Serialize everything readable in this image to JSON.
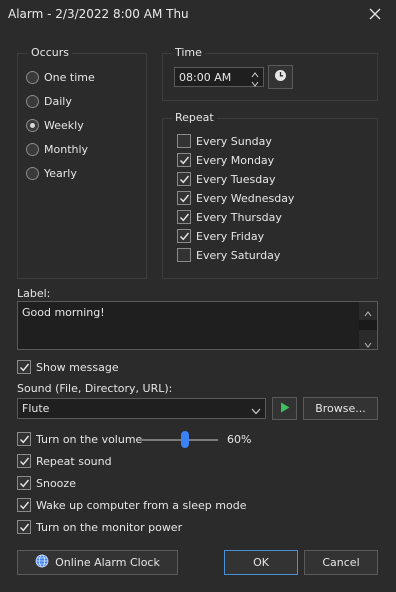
{
  "window": {
    "title": "Alarm - 2/3/2022 8:00 AM Thu"
  },
  "occurs": {
    "legend": "Occurs",
    "options": [
      {
        "label": "One time",
        "selected": false
      },
      {
        "label": "Daily",
        "selected": false
      },
      {
        "label": "Weekly",
        "selected": true
      },
      {
        "label": "Monthly",
        "selected": false
      },
      {
        "label": "Yearly",
        "selected": false
      }
    ]
  },
  "time": {
    "legend": "Time",
    "value": "08:00 AM"
  },
  "repeat": {
    "legend": "Repeat",
    "days": [
      {
        "label": "Every Sunday",
        "checked": false
      },
      {
        "label": "Every Monday",
        "checked": true
      },
      {
        "label": "Every Tuesday",
        "checked": true
      },
      {
        "label": "Every Wednesday",
        "checked": true
      },
      {
        "label": "Every Thursday",
        "checked": true
      },
      {
        "label": "Every Friday",
        "checked": true
      },
      {
        "label": "Every Saturday",
        "checked": false
      }
    ]
  },
  "label": {
    "caption": "Label:",
    "value": "Good morning!"
  },
  "show_message": {
    "label": "Show message",
    "checked": true
  },
  "sound": {
    "caption": "Sound (File, Directory, URL):",
    "value": "Flute",
    "browse_label": "Browse..."
  },
  "volume": {
    "label": "Turn on the volume",
    "checked": true,
    "value_text": "60%",
    "level": 0.6
  },
  "options": [
    {
      "label": "Repeat sound",
      "checked": true
    },
    {
      "label": "Snooze",
      "checked": true
    },
    {
      "label": "Wake up computer from a sleep mode",
      "checked": true
    },
    {
      "label": "Turn on the monitor power",
      "checked": true
    }
  ],
  "buttons": {
    "online": "Online Alarm Clock",
    "ok": "OK",
    "cancel": "Cancel"
  },
  "colors": {
    "accent": "#3b82f6",
    "play": "#3fbf5f",
    "background": "#2b2b2b"
  }
}
